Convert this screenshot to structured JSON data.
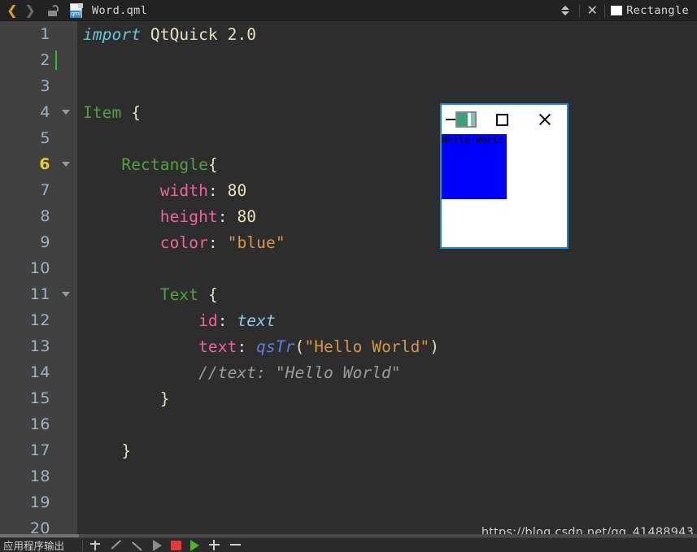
{
  "topbar": {
    "back_icon": "chevron-left-icon",
    "forward_icon": "chevron-right-icon",
    "lock_icon": "unlocked-padlock-icon",
    "file_icon_label": "qml",
    "file_name": "Word.qml",
    "spinner_icon": "up-down-spinner-icon",
    "close_icon": "close-x-icon",
    "symbol_swatch_icon": "rectangle-swatch-icon",
    "symbol_label": "Rectangle"
  },
  "editor": {
    "current_line": 6,
    "cursor_line": 2,
    "total_visible_lines": 20,
    "lines": [
      {
        "n": "1",
        "fold": false,
        "cursor": false,
        "tokens": [
          {
            "t": "import ",
            "c": "kw"
          },
          {
            "t": "QtQuick ",
            "c": "plain"
          },
          {
            "t": "2.0",
            "c": "num"
          }
        ]
      },
      {
        "n": "2",
        "fold": false,
        "cursor": true,
        "tokens": []
      },
      {
        "n": "3",
        "fold": false,
        "cursor": false,
        "tokens": []
      },
      {
        "n": "4",
        "fold": true,
        "cursor": false,
        "tokens": [
          {
            "t": "Item ",
            "c": "type"
          },
          {
            "t": "{",
            "c": "brace"
          }
        ]
      },
      {
        "n": "5",
        "fold": false,
        "cursor": false,
        "tokens": []
      },
      {
        "n": "6",
        "fold": true,
        "cursor": false,
        "tokens": [
          {
            "t": "    ",
            "c": "plain"
          },
          {
            "t": "Rectangle",
            "c": "type"
          },
          {
            "t": "{",
            "c": "brace"
          }
        ]
      },
      {
        "n": "7",
        "fold": false,
        "cursor": false,
        "tokens": [
          {
            "t": "        ",
            "c": "plain"
          },
          {
            "t": "width",
            "c": "prop"
          },
          {
            "t": ": ",
            "c": "punct"
          },
          {
            "t": "80",
            "c": "num"
          }
        ]
      },
      {
        "n": "8",
        "fold": false,
        "cursor": false,
        "tokens": [
          {
            "t": "        ",
            "c": "plain"
          },
          {
            "t": "height",
            "c": "prop"
          },
          {
            "t": ": ",
            "c": "punct"
          },
          {
            "t": "80",
            "c": "num"
          }
        ]
      },
      {
        "n": "9",
        "fold": false,
        "cursor": false,
        "tokens": [
          {
            "t": "        ",
            "c": "plain"
          },
          {
            "t": "color",
            "c": "prop"
          },
          {
            "t": ": ",
            "c": "punct"
          },
          {
            "t": "\"blue\"",
            "c": "str"
          }
        ]
      },
      {
        "n": "10",
        "fold": false,
        "cursor": false,
        "tokens": []
      },
      {
        "n": "11",
        "fold": true,
        "cursor": false,
        "tokens": [
          {
            "t": "        ",
            "c": "plain"
          },
          {
            "t": "Text ",
            "c": "type"
          },
          {
            "t": "{",
            "c": "brace"
          }
        ]
      },
      {
        "n": "12",
        "fold": false,
        "cursor": false,
        "tokens": [
          {
            "t": "            ",
            "c": "plain"
          },
          {
            "t": "id",
            "c": "prop"
          },
          {
            "t": ": ",
            "c": "punct"
          },
          {
            "t": "text",
            "c": "ident"
          }
        ]
      },
      {
        "n": "13",
        "fold": false,
        "cursor": false,
        "tokens": [
          {
            "t": "            ",
            "c": "plain"
          },
          {
            "t": "text",
            "c": "prop"
          },
          {
            "t": ": ",
            "c": "punct"
          },
          {
            "t": "qsTr",
            "c": "func"
          },
          {
            "t": "(",
            "c": "punct"
          },
          {
            "t": "\"Hello World\"",
            "c": "str"
          },
          {
            "t": ")",
            "c": "punct"
          }
        ]
      },
      {
        "n": "14",
        "fold": false,
        "cursor": false,
        "tokens": [
          {
            "t": "            ",
            "c": "plain"
          },
          {
            "t": "//text: \"Hello World\"",
            "c": "comment"
          }
        ]
      },
      {
        "n": "15",
        "fold": false,
        "cursor": false,
        "tokens": [
          {
            "t": "        ",
            "c": "plain"
          },
          {
            "t": "}",
            "c": "brace"
          }
        ]
      },
      {
        "n": "16",
        "fold": false,
        "cursor": false,
        "tokens": []
      },
      {
        "n": "17",
        "fold": false,
        "cursor": false,
        "tokens": [
          {
            "t": "    ",
            "c": "plain"
          },
          {
            "t": "}",
            "c": "brace"
          }
        ]
      },
      {
        "n": "18",
        "fold": false,
        "cursor": false,
        "tokens": []
      },
      {
        "n": "19",
        "fold": false,
        "cursor": false,
        "tokens": []
      },
      {
        "n": "20",
        "fold": false,
        "cursor": false,
        "tokens": []
      }
    ]
  },
  "popup": {
    "minimize_icon": "minimize-window-icon",
    "maximize_icon": "maximize-window-icon",
    "close_icon": "close-window-icon",
    "rect_color": "#0000ff",
    "rect_width": 80,
    "rect_height": 80,
    "text": "Hello World",
    "border_color": "#1e8ad6"
  },
  "watermark": {
    "url": "https://blog.csdn.net/qq_41488943"
  },
  "bottombar": {
    "panel_label": "应用程序输出",
    "icons": [
      "anchor-icon",
      "arrow-up-left-icon",
      "arrow-down-right-icon",
      "play-gray-icon",
      "stop-red-icon",
      "play-green-icon",
      "plus-icon",
      "minus-icon"
    ]
  }
}
